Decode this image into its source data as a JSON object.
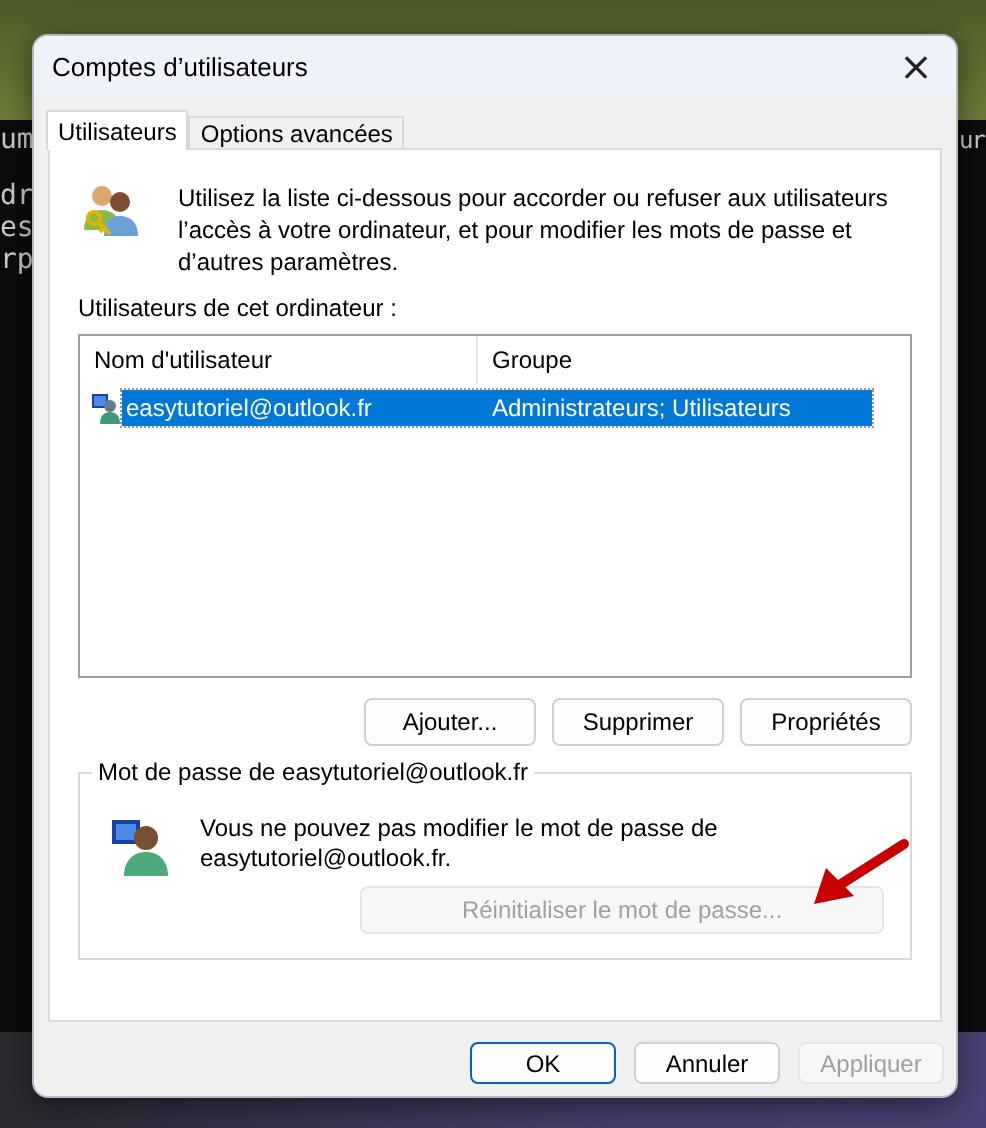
{
  "background_text": {
    "left": [
      "um",
      "dr",
      "es",
      "rp"
    ],
    "right": [
      "ur"
    ]
  },
  "window": {
    "title": "Comptes d’utilisateurs",
    "close": "×"
  },
  "tabs": [
    {
      "label": "Utilisateurs",
      "selected": true
    },
    {
      "label": "Options avancées",
      "selected": false
    }
  ],
  "intro": "Utilisez la liste ci-dessous pour accorder ou refuser aux utilisateurs l’accès à votre ordinateur, et pour modifier les mots de passe et d’autres paramètres.",
  "users_label": "Utilisateurs de cet ordinateur :",
  "table": {
    "columns": [
      "Nom d'utilisateur",
      "Groupe"
    ],
    "rows": [
      {
        "cells": [
          "easytutoriel@outlook.fr",
          "Administrateurs; Utilisateurs"
        ],
        "selected": true
      }
    ]
  },
  "user_buttons": [
    {
      "label": "Ajouter...",
      "disabled": false
    },
    {
      "label": "Supprimer",
      "disabled": false
    },
    {
      "label": "Propriétés",
      "disabled": false
    }
  ],
  "password_group": {
    "title": "Mot de passe de easytutoriel@outlook.fr",
    "message": "Vous ne pouvez pas modifier le mot de passe de easytutoriel@outlook.fr.",
    "button": {
      "label": "Réinitialiser le mot de passe...",
      "disabled": true
    }
  },
  "annotations": [
    {
      "kind": "arrow"
    }
  ],
  "footer_buttons": [
    {
      "label": "OK",
      "kind": "default",
      "disabled": false
    },
    {
      "label": "Annuler",
      "kind": "normal",
      "disabled": false
    },
    {
      "label": "Appliquer",
      "kind": "normal",
      "disabled": true
    }
  ]
}
